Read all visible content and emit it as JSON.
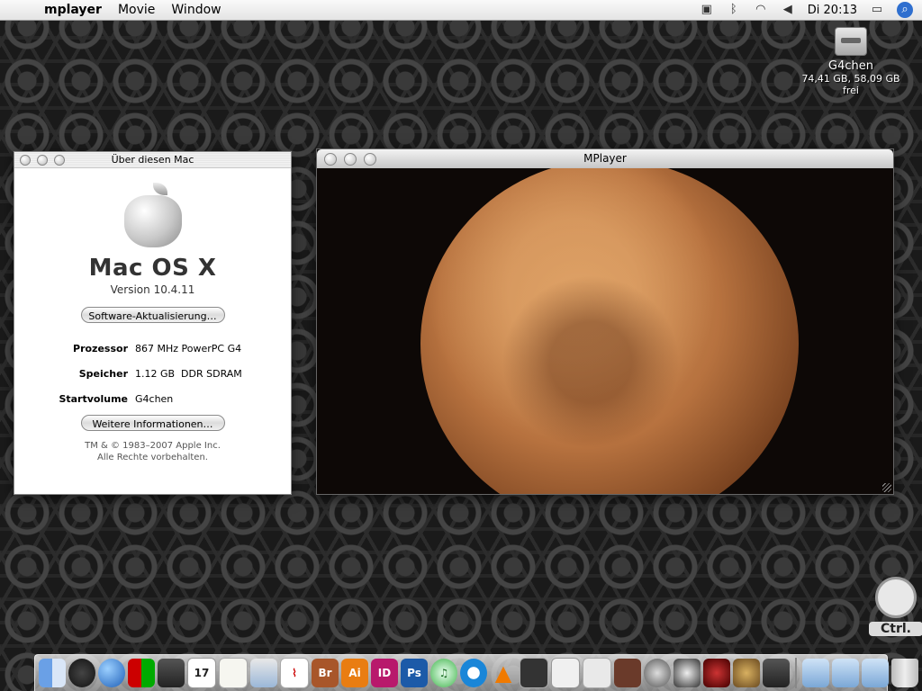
{
  "menubar": {
    "app_name": "mplayer",
    "menus": [
      "Movie",
      "Window"
    ],
    "clock": "Di 20:13"
  },
  "desktop": {
    "drive_name": "G4chen",
    "drive_info": "74,41 GB, 58,09 GB frei"
  },
  "about_window": {
    "title": "Über diesen Mac",
    "os_name": "Mac OS X",
    "version": "Version 10.4.11",
    "update_button": "Software-Aktualisierung…",
    "specs": [
      {
        "label": "Prozessor",
        "value": "867 MHz PowerPC G4"
      },
      {
        "label": "Speicher",
        "value": "1.12 GB  DDR SDRAM"
      },
      {
        "label": "Startvolume",
        "value": "G4chen"
      }
    ],
    "more_button": "Weitere Informationen…",
    "copyright_line1": "TM & © 1983–2007 Apple Inc.",
    "copyright_line2": "Alle Rechte vorbehalten."
  },
  "mplayer_window": {
    "title": "MPlayer"
  },
  "ctrl_badge": "Ctrl.",
  "dock": {
    "calendar_day": "17",
    "bridge_label": "Br",
    "illustrator_label": "Ai",
    "indesign_label": "ID",
    "photoshop_label": "Ps"
  }
}
